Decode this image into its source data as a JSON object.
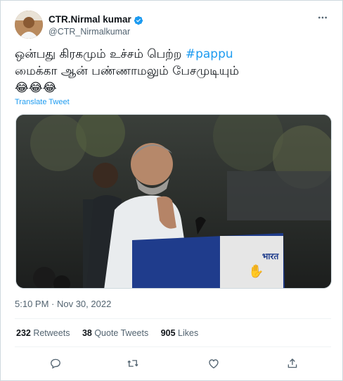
{
  "user": {
    "display_name": "CTR.Nirmal kumar",
    "handle": "@CTR_Nirmalkumar",
    "verified": true
  },
  "tweet": {
    "line1": "ஒன்பது கிரகமும் உச்சம் பெற்ற ",
    "hashtag": "#pappu",
    "line2": "மைக்கா ஆன் பண்ணாமலும் பேசமுடியும்",
    "emojis": "😂😂😂",
    "translate_label": "Translate Tweet"
  },
  "timestamp": "5:10 PM · Nov 30, 2022",
  "stats": {
    "retweets_count": "232",
    "retweets_label": " Retweets",
    "quotes_count": "38",
    "quotes_label": " Quote Tweets",
    "likes_count": "905",
    "likes_label": " Likes"
  },
  "icons": [
    "more-icon",
    "verified-icon",
    "reply-icon",
    "retweet-icon",
    "like-icon",
    "share-icon"
  ],
  "colors": {
    "accent": "#1d9bf0",
    "text": "#0f1419",
    "muted": "#536471",
    "border": "#cfd9de"
  }
}
